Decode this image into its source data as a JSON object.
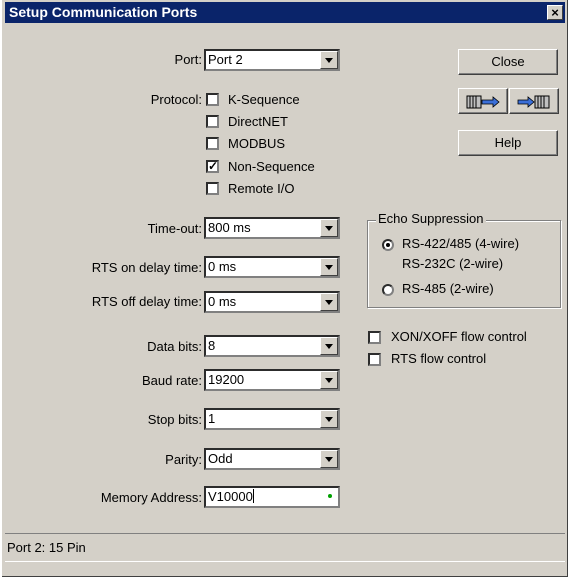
{
  "window": {
    "title": "Setup Communication Ports",
    "close_glyph": "×"
  },
  "port": {
    "label": "Port:",
    "value": "Port 2"
  },
  "protocol": {
    "label": "Protocol:",
    "options": [
      {
        "label": "K-Sequence",
        "checked": false
      },
      {
        "label": "DirectNET",
        "checked": false
      },
      {
        "label": "MODBUS",
        "checked": false
      },
      {
        "label": "Non-Sequence",
        "checked": true
      },
      {
        "label": "Remote I/O",
        "checked": false
      }
    ]
  },
  "timeout": {
    "label": "Time-out:",
    "value": "800 ms"
  },
  "rts_on": {
    "label": "RTS on delay time:",
    "value": "0 ms"
  },
  "rts_off": {
    "label": "RTS off delay time:",
    "value": "0 ms"
  },
  "data_bits": {
    "label": "Data bits:",
    "value": "8"
  },
  "baud_rate": {
    "label": "Baud rate:",
    "value": "19200"
  },
  "stop_bits": {
    "label": "Stop bits:",
    "value": "1"
  },
  "parity": {
    "label": "Parity:",
    "value": "Odd"
  },
  "memory_address": {
    "label": "Memory Address:",
    "value": "V10000"
  },
  "buttons": {
    "close": "Close",
    "help": "Help",
    "read_icon": "read-from-plc-icon",
    "write_icon": "write-to-plc-icon"
  },
  "echo": {
    "title": "Echo Suppression",
    "option1_line1": "RS-422/485 (4-wire)",
    "option1_line2": "RS-232C (2-wire)",
    "option2": "RS-485 (2-wire)",
    "selected": "option1"
  },
  "flow": {
    "xon": {
      "label": "XON/XOFF flow control",
      "checked": false
    },
    "rts": {
      "label": "RTS flow control",
      "checked": false
    }
  },
  "status": {
    "text": "Port 2: 15 Pin"
  },
  "colors": {
    "titlebar": "#0a246a",
    "dialog_bg": "#d4d0c8",
    "valid_dot": "#00a000"
  }
}
